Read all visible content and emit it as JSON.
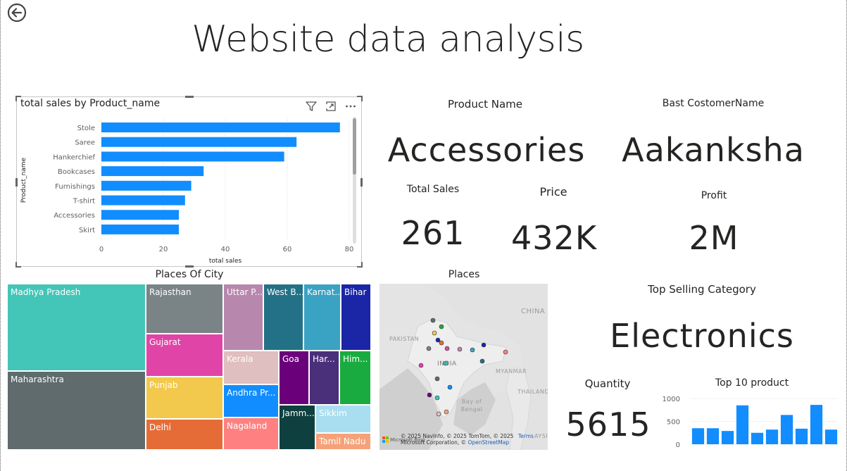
{
  "page": {
    "title": "Website data analysis"
  },
  "bar_visual": {
    "title": "total sales by Product_name",
    "xlabel": "total sales",
    "ylabel": "Product_name"
  },
  "cards": {
    "product_name": {
      "label": "Product Name",
      "value": "Accessories"
    },
    "best_customer": {
      "label": "Bast CostomerName",
      "value": "Aakanksha"
    },
    "total_sales": {
      "label": "Total Sales",
      "value": "261"
    },
    "price": {
      "label": "Price",
      "value": "432K"
    },
    "profit": {
      "label": "Profit",
      "value": "2M"
    },
    "top_category": {
      "label": "Top Selling Category",
      "value": "Electronics"
    },
    "quantity": {
      "label": "Quantity",
      "value": "5615"
    }
  },
  "treemap": {
    "title": "Places Of City",
    "cells": [
      {
        "label": "Madhya Pradesh",
        "color": "#43C5B8"
      },
      {
        "label": "Maharashtra",
        "color": "#5F6B6D"
      },
      {
        "label": "Rajasthan",
        "color": "#7A8487"
      },
      {
        "label": "Gujarat",
        "color": "#E044A7"
      },
      {
        "label": "Punjab",
        "color": "#F2C94C"
      },
      {
        "label": "Delhi",
        "color": "#E66C37"
      },
      {
        "label": "Uttar P...",
        "color": "#B887AD"
      },
      {
        "label": "West B...",
        "color": "#237186"
      },
      {
        "label": "Karnat...",
        "color": "#3AA2C3"
      },
      {
        "label": "Bihar",
        "color": "#1A26A6"
      },
      {
        "label": "Kerala",
        "color": "#DFBFBF"
      },
      {
        "label": "Goa",
        "color": "#6B007B"
      },
      {
        "label": "Har...",
        "color": "#4A2F7A"
      },
      {
        "label": "Him...",
        "color": "#1AAB40"
      },
      {
        "label": "Andhra Pr...",
        "color": "#118DFF"
      },
      {
        "label": "Nagaland",
        "color": "#FF8080"
      },
      {
        "label": "Jamm...",
        "color": "#0F4040"
      },
      {
        "label": "Sikkim",
        "color": "#A9DDF0"
      },
      {
        "label": "Tamil Nadu",
        "color": "#F5A27A"
      }
    ]
  },
  "map": {
    "title": "Places",
    "labels": [
      "CHINA",
      "PAKISTAN",
      "INDIA",
      "MYANMAR",
      "THAILAND",
      "Bay of Bengal",
      "AYSIA"
    ],
    "attribution_line1": "© 2025 NavInfo, © 2025 TomTom, © 2025",
    "attribution_terms": "Terms",
    "attribution_line2": "Microsoft Corporation, ©",
    "attribution_osm": "OpenStreetMap",
    "logo": "Microsoft Bing"
  },
  "mini_chart": {
    "title": "Top 10 product"
  },
  "colors": {
    "bar": "#118DFF",
    "text": "#252423"
  },
  "icons": [
    "back-arrow-icon",
    "filter-icon",
    "focus-mode-icon",
    "more-options-icon"
  ],
  "chart_data": [
    {
      "type": "bar",
      "orientation": "horizontal",
      "title": "total sales by Product_name",
      "xlabel": "total sales",
      "ylabel": "Product_name",
      "categories": [
        "Stole",
        "Saree",
        "Hankerchief",
        "Bookcases",
        "Furnishings",
        "T-shirt",
        "Accessories",
        "Skirt"
      ],
      "values": [
        77,
        63,
        59,
        33,
        29,
        27,
        25,
        25
      ],
      "xlim": [
        0,
        80
      ],
      "xticks": [
        0,
        20,
        40,
        60,
        80
      ],
      "grid": true
    },
    {
      "type": "bar",
      "title": "Top 10 product",
      "values": [
        350,
        350,
        290,
        850,
        250,
        320,
        640,
        340,
        860,
        320
      ],
      "ylim": [
        0,
        1000
      ],
      "yticks": [
        0,
        500,
        1000
      ],
      "grid": true
    }
  ]
}
